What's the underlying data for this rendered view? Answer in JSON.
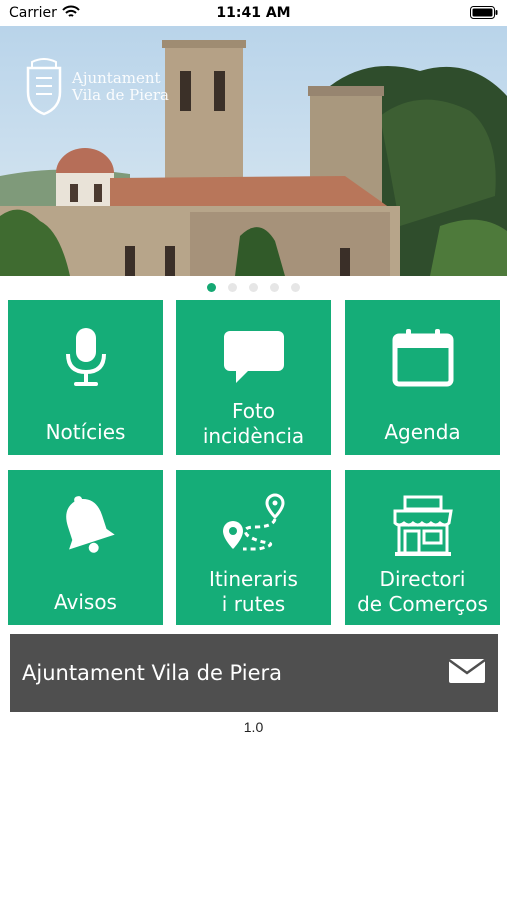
{
  "status_bar": {
    "carrier": "Carrier",
    "time": "11:41 AM"
  },
  "banner": {
    "logo_line1": "Ajuntament",
    "logo_line2": "Vila de Piera",
    "page_count": 5,
    "active_page": 1
  },
  "tiles": [
    {
      "label": "Notícies",
      "icon": "microphone-icon"
    },
    {
      "label": "Foto\nincidència",
      "icon": "speech-bubble-icon"
    },
    {
      "label": "Agenda",
      "icon": "calendar-icon"
    },
    {
      "label": "Avisos",
      "icon": "bell-icon"
    },
    {
      "label": "Itineraris\ni rutes",
      "icon": "route-map-icon"
    },
    {
      "label": "Directori\nde Comerços",
      "icon": "shop-icon"
    }
  ],
  "footer": {
    "title": "Ajuntament Vila de Piera",
    "icon": "envelope-icon"
  },
  "version": "1.0",
  "colors": {
    "tile_green": "#15ad78",
    "footer_gray": "#4f4f4f",
    "dot_active": "#15a873"
  }
}
